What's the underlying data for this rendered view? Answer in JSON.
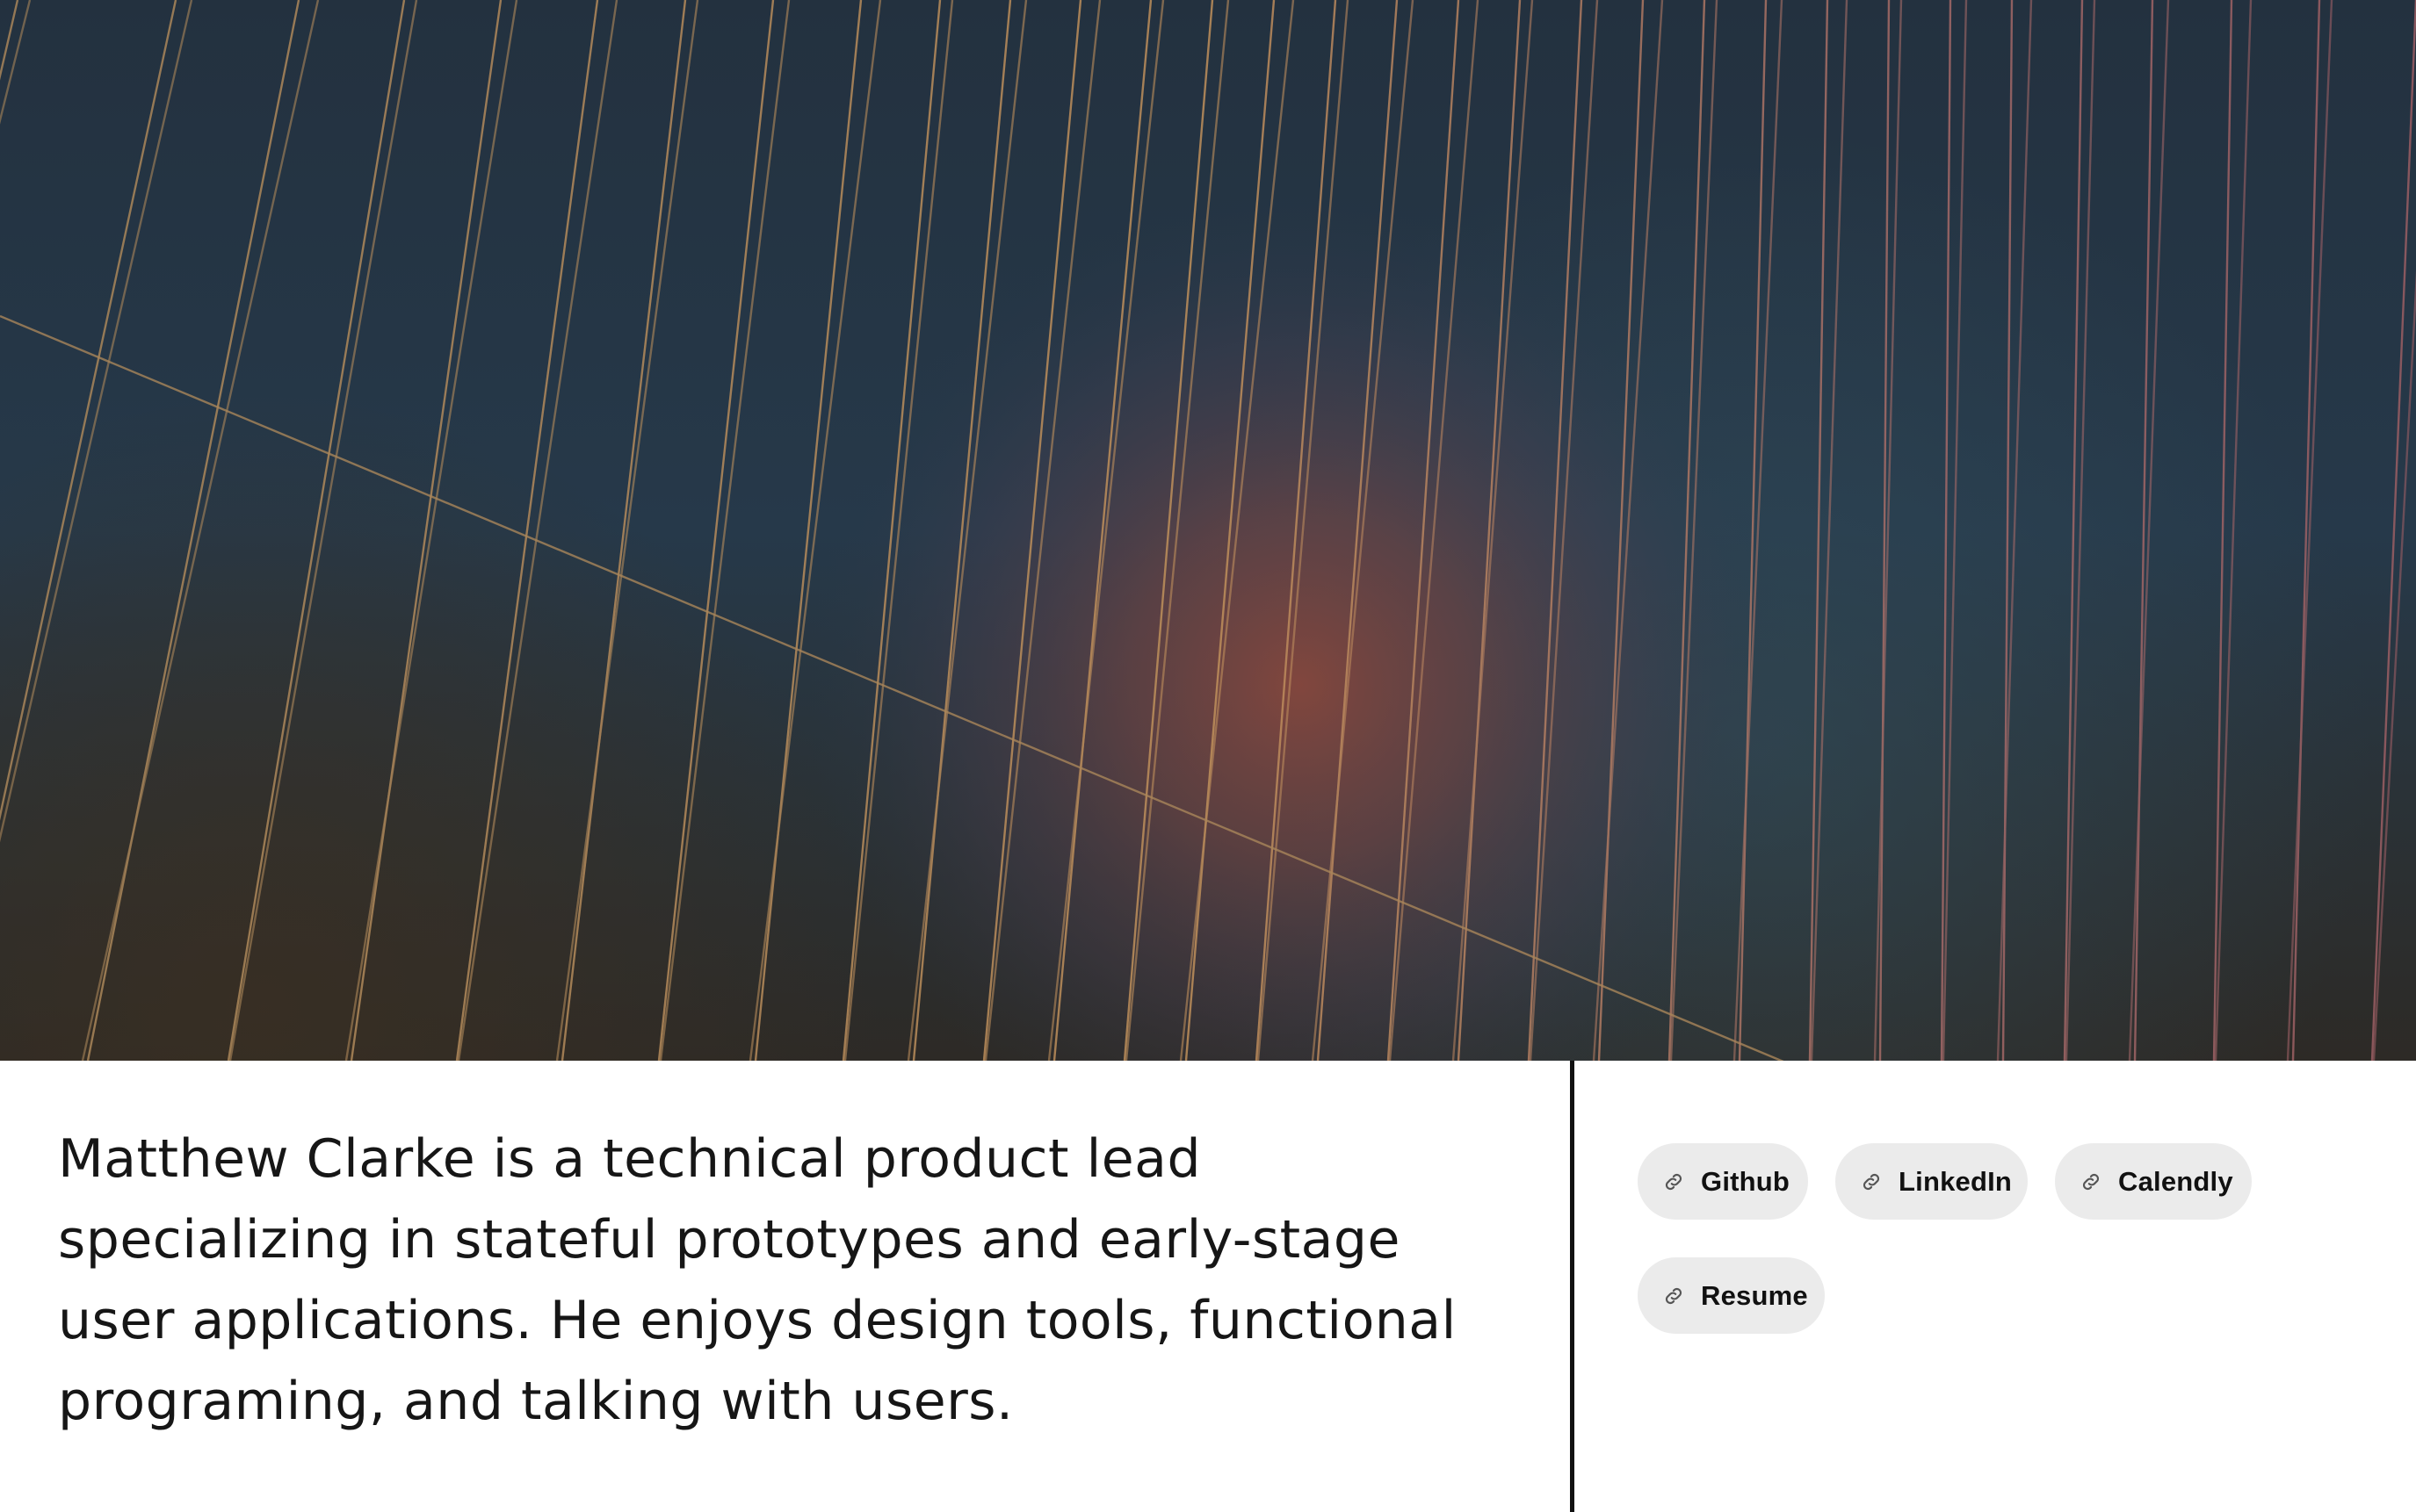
{
  "bio": {
    "text": "Matthew Clarke is a technical product lead specializing in stateful prototypes and early-stage user applications. He enjoys design tools, functional programing, and talking with users."
  },
  "links": [
    {
      "label": "Github",
      "icon": "link-icon"
    },
    {
      "label": "LinkedIn",
      "icon": "link-icon"
    },
    {
      "label": "Calendly",
      "icon": "link-icon"
    },
    {
      "label": "Resume",
      "icon": "link-icon"
    }
  ],
  "colors": {
    "background_dark": "#233444",
    "glow_red": "#7a4540",
    "line_gold": "#b88d5e",
    "chip_bg": "#ebebeb",
    "text": "#161616",
    "divider": "#111111"
  }
}
